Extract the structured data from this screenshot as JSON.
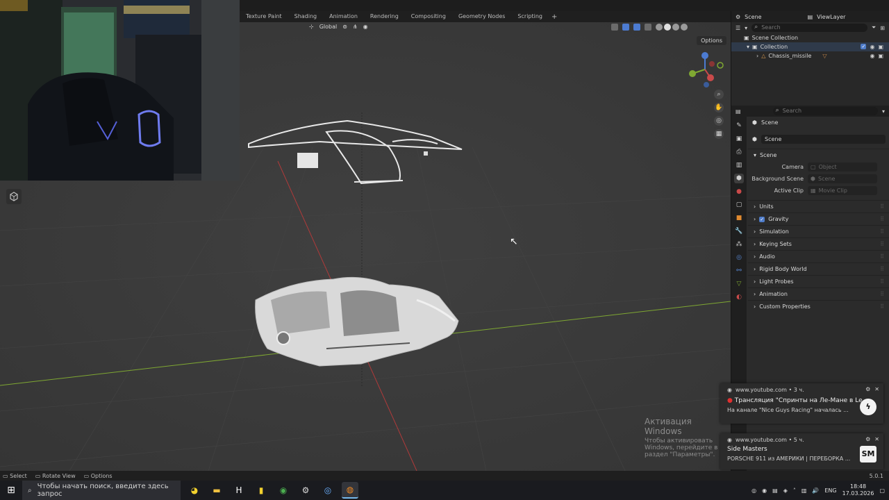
{
  "topbar": {
    "tabs": [
      "Texture Paint",
      "Shading",
      "Animation",
      "Rendering",
      "Compositing",
      "Geometry Nodes",
      "Scripting"
    ],
    "add": "+"
  },
  "viewport": {
    "transform_orientation": "Global",
    "options_label": "Options",
    "cursor": "↖"
  },
  "watermark": {
    "title": "Активация Windows",
    "subtitle": "Чтобы активировать Windows, перейдите в раздел \"Параметры\"."
  },
  "outliner": {
    "scene_label": "Scene",
    "view_layer_label": "ViewLayer",
    "search_placeholder": "Search",
    "scene_collection": "Scene Collection",
    "collection": "Collection",
    "object": "Chassis_missile"
  },
  "properties": {
    "search_placeholder": "Search",
    "breadcrumb": "Scene",
    "scene_field": "Scene",
    "panel_scene": "Scene",
    "camera_label": "Camera",
    "camera_placeholder": "Object",
    "bg_scene_label": "Background Scene",
    "bg_scene_placeholder": "Scene",
    "active_clip_label": "Active Clip",
    "active_clip_placeholder": "Movie Clip",
    "panels": [
      "Units",
      "Gravity",
      "Simulation",
      "Keying Sets",
      "Audio",
      "Rigid Body World",
      "Light Probes",
      "Animation",
      "Custom Properties"
    ],
    "gravity_checked": true
  },
  "notifications": [
    {
      "source": "www.youtube.com • 3 ч.",
      "title": "Трансляция \"Спринты на Ле-Мане в Le ...",
      "body": "На канале \"Nice Guys Racing\" началась ...",
      "thumb": "ϟ"
    },
    {
      "source": "www.youtube.com • 5 ч.",
      "title": "Side Masters",
      "body": "PORSCHE 911 из АМЕРИКИ | ПЕРЕБОРКА ...",
      "thumb": "SM"
    }
  ],
  "statusbar": {
    "select": "Select",
    "rotate": "Rotate View",
    "options": "Options",
    "version": "5.0.1"
  },
  "taskbar": {
    "search_placeholder": "Чтобы начать поиск, введите здесь запрос",
    "lang": "ENG",
    "time": "18:48",
    "date": "17.03.2026"
  },
  "colors": {
    "accent": "#4c7bd1",
    "viewport_bg": "#3b3b3b",
    "x_axis": "#b03a3a",
    "y_axis": "#7fa832"
  }
}
